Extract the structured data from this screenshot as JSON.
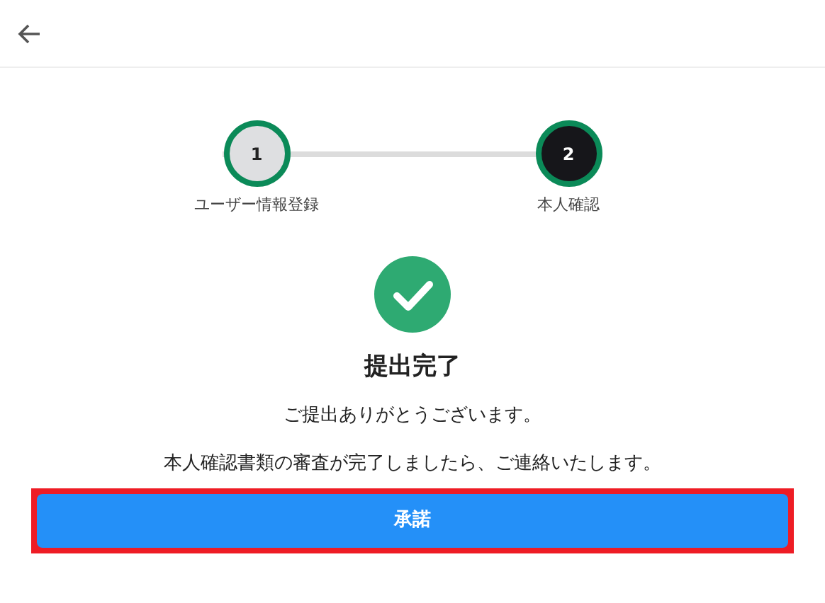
{
  "steps": [
    {
      "number": "1",
      "label": "ユーザー情報登録",
      "selected": false
    },
    {
      "number": "2",
      "label": "本人確認",
      "selected": true
    }
  ],
  "title": "提出完了",
  "messages": [
    "ご提出ありがとうございます。",
    "本人確認書類の審査が完了しましたら、ご連絡いたします。"
  ],
  "button": {
    "label": "承諾",
    "highlighted": true
  }
}
